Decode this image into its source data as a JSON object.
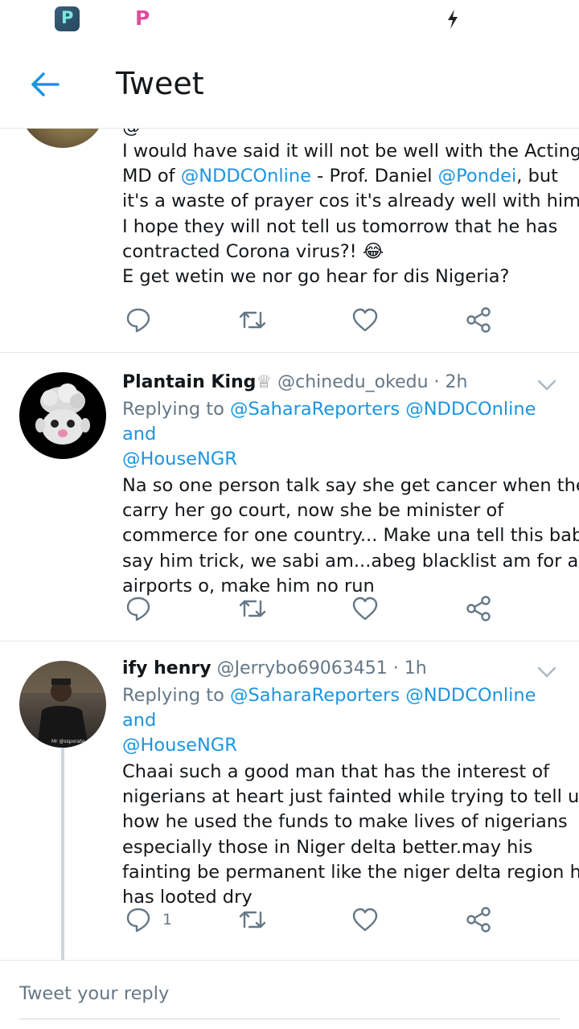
{
  "status_bar": {
    "icons": [
      "picsart-app-icon",
      "picsart-logo-icon",
      "charging-bolt-icon"
    ],
    "app_letter": "P"
  },
  "header": {
    "title": "Tweet",
    "back_icon": "arrow-left-icon"
  },
  "colors": {
    "accent": "#1b95e0",
    "text": "#14171a",
    "secondary": "#657786",
    "divider": "#e1e8ed"
  },
  "tweets": [
    {
      "partial_top": "@",
      "text_lines": [
        [
          {
            "t": "I would have said it will not be well with the Acting"
          }
        ],
        [
          {
            "t": "MD of "
          },
          {
            "t": "@NDDCOnline",
            "m": true
          },
          {
            "t": " - Prof. Daniel "
          },
          {
            "t": "@Pondei",
            "m": true
          },
          {
            "t": ", but"
          }
        ],
        [
          {
            "t": "it's a waste of prayer cos it's already well with him."
          }
        ],
        [
          {
            "t": "I hope they will not tell us tomorrow that he has"
          }
        ],
        [
          {
            "t": "contracted Corona virus?! 😂"
          }
        ],
        [
          {
            "t": "E get wetin we nor go hear for dis Nigeria?"
          }
        ]
      ],
      "reply_count": "",
      "icons": [
        "reply-icon",
        "retweet-icon",
        "like-icon",
        "share-icon"
      ]
    },
    {
      "name": "Plantain King",
      "crown": "♕",
      "handle": "@chinedu_okedu",
      "time": "· 2h",
      "replying_label": "Replying to",
      "replying_mentions_line1": "@SaharaReporters @NDDCOnline and",
      "replying_mentions_line2": "@HouseNGR",
      "text_lines": [
        [
          {
            "t": "Na so one person talk say she get cancer when them"
          }
        ],
        [
          {
            "t": "carry her go court, now she be minister of"
          }
        ],
        [
          {
            "t": "commerce for one country... Make una tell this baba"
          }
        ],
        [
          {
            "t": "say him trick, we sabi am...abeg blacklist am for all"
          }
        ],
        [
          {
            "t": "airports o, make him no run"
          }
        ]
      ],
      "reply_count": ""
    },
    {
      "name": "ify henry",
      "handle": "@Jerrybo69063451",
      "time": "· 1h",
      "avatar_caption": "Mr @ssporate",
      "replying_label": "Replying to",
      "replying_mentions_line1": "@SaharaReporters @NDDCOnline and",
      "replying_mentions_line2": "@HouseNGR",
      "text_lines": [
        [
          {
            "t": "Chaai such a good man that has the interest of"
          }
        ],
        [
          {
            "t": "nigerians at heart just fainted while trying to tell us"
          }
        ],
        [
          {
            "t": "how he used the funds to make lives of nigerians"
          }
        ],
        [
          {
            "t": "especially those in Niger delta better.may his"
          }
        ],
        [
          {
            "t": "fainting be permanent like the niger delta region he"
          }
        ],
        [
          {
            "t": "has looted dry"
          }
        ]
      ],
      "reply_count": "1"
    }
  ],
  "reply_bar": {
    "placeholder": "Tweet your reply"
  }
}
